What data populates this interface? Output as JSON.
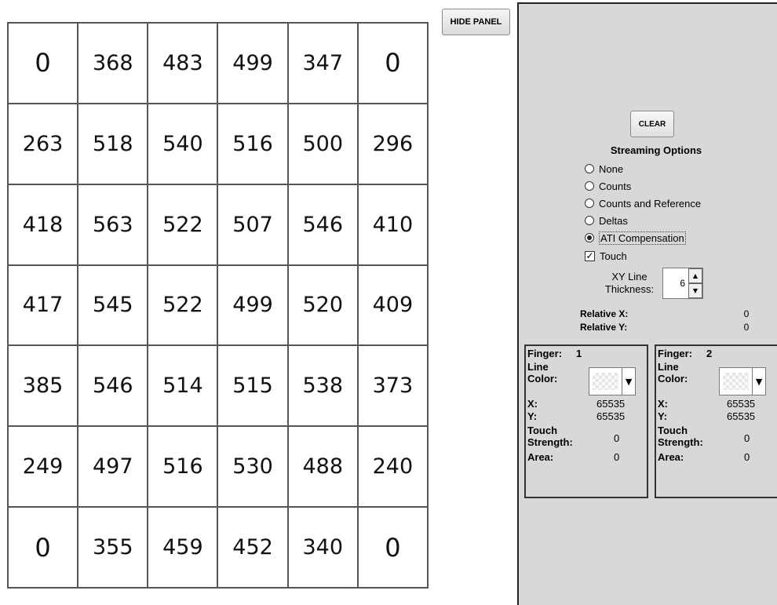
{
  "grid": {
    "rows": [
      [
        "0",
        "368",
        "483",
        "499",
        "347",
        "0"
      ],
      [
        "263",
        "518",
        "540",
        "516",
        "500",
        "296"
      ],
      [
        "418",
        "563",
        "522",
        "507",
        "546",
        "410"
      ],
      [
        "417",
        "545",
        "522",
        "499",
        "520",
        "409"
      ],
      [
        "385",
        "546",
        "514",
        "515",
        "538",
        "373"
      ],
      [
        "249",
        "497",
        "516",
        "530",
        "488",
        "240"
      ],
      [
        "0",
        "355",
        "459",
        "452",
        "340",
        "0"
      ]
    ]
  },
  "header": {
    "hide_panel_label": "HIDE PANEL"
  },
  "panel": {
    "clear_label": "CLEAR",
    "streaming_title": "Streaming Options",
    "streaming_options": [
      "None",
      "Counts",
      "Counts and Reference",
      "Deltas",
      "ATI Compensation"
    ],
    "selected_option": "ATI Compensation",
    "touch_label": "Touch",
    "touch_checked": true,
    "xy_line_label": "XY Line Thickness:",
    "xy_line_value": "6",
    "relative_x_label": "Relative X:",
    "relative_x_value": "0",
    "relative_y_label": "Relative Y:",
    "relative_y_value": "0",
    "fingers": [
      {
        "finger_label": "Finger:",
        "finger_number": "1",
        "line_color_label": "Line Color:",
        "x_label": "X:",
        "x_value": "65535",
        "y_label": "Y:",
        "y_value": "65535",
        "touch_strength_label": "Touch Strength:",
        "touch_strength_value": "0",
        "area_label": "Area:",
        "area_value": "0"
      },
      {
        "finger_label": "Finger:",
        "finger_number": "2",
        "line_color_label": "Line Color:",
        "x_label": "X:",
        "x_value": "65535",
        "y_label": "Y:",
        "y_value": "65535",
        "touch_strength_label": "Touch Strength:",
        "touch_strength_value": "0",
        "area_label": "Area:",
        "area_value": "0"
      }
    ]
  },
  "colors": {
    "panel_bg": "#d8d8d8",
    "border": "#222222"
  },
  "icons": {
    "dropdown": "chevron-down-icon",
    "spin_up": "arrow-up-icon",
    "spin_down": "arrow-down-icon"
  }
}
